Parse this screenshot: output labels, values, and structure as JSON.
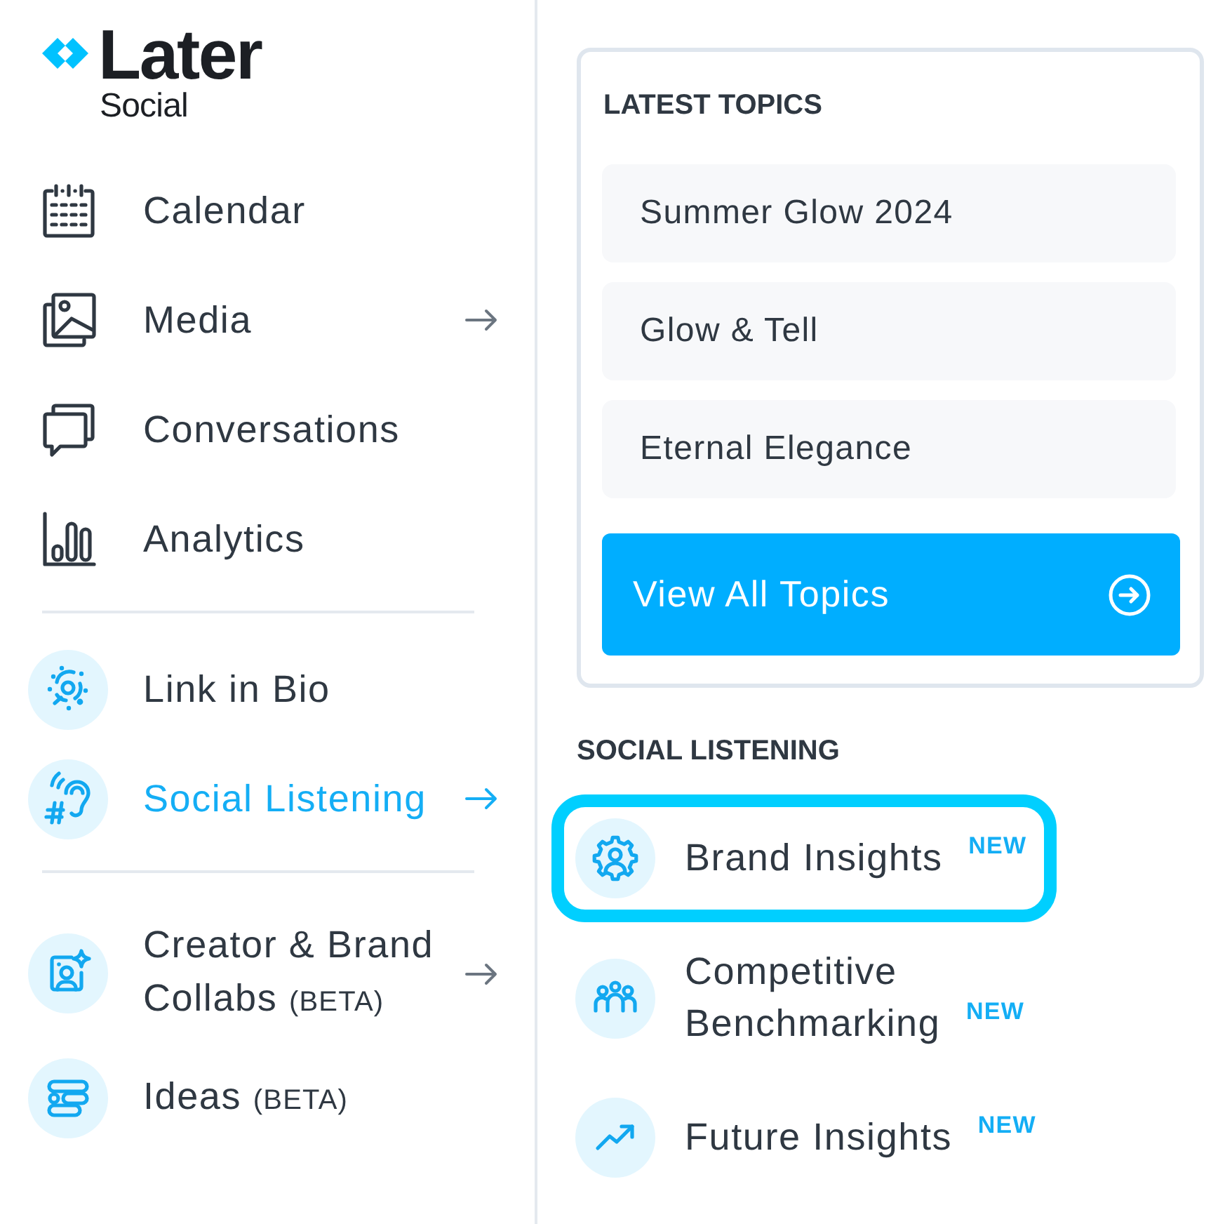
{
  "logo": {
    "wordmark": "Later",
    "product": "Social"
  },
  "nav": {
    "groups": [
      {
        "items": [
          {
            "label": "Calendar",
            "selected": false,
            "submenu": false
          },
          {
            "label": "Media",
            "selected": false,
            "submenu": true
          },
          {
            "label": "Conversations",
            "selected": false,
            "submenu": false
          },
          {
            "label": "Analytics",
            "selected": false,
            "submenu": false
          }
        ]
      },
      {
        "items": [
          {
            "label": "Link in Bio",
            "selected": false,
            "submenu": false
          },
          {
            "label": "Social Listening",
            "selected": true,
            "submenu": true
          }
        ]
      },
      {
        "items": [
          {
            "label": "Creator & Brand Collabs",
            "tag": "(BETA)",
            "selected": false,
            "submenu": true
          },
          {
            "label": "Ideas",
            "tag": "(BETA)",
            "selected": false,
            "submenu": false
          }
        ]
      }
    ]
  },
  "latest_topics": {
    "heading": "LATEST TOPICS",
    "topics": [
      "Summer Glow 2024",
      "Glow & Tell",
      "Eternal Elegance"
    ],
    "button": "View All Topics"
  },
  "social_listening": {
    "heading": "SOCIAL LISTENING",
    "items": [
      {
        "label": "Brand Insights",
        "badge": "NEW",
        "highlighted": true
      },
      {
        "label": "Competitive Benchmarking",
        "badge": "NEW",
        "highlighted": false
      },
      {
        "label": "Future Insights",
        "badge": "NEW",
        "highlighted": false
      }
    ]
  }
}
